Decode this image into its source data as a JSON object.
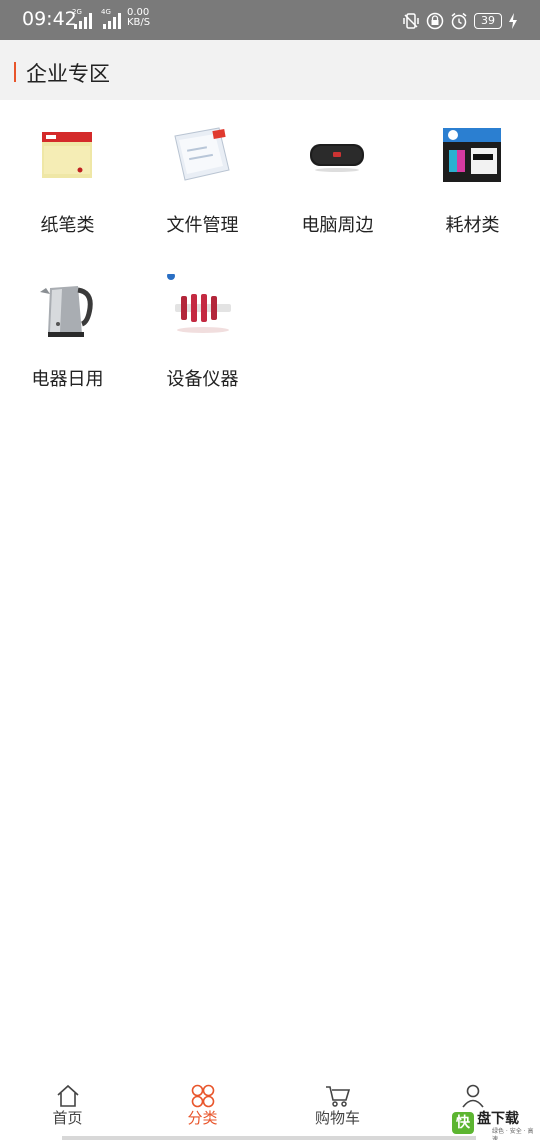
{
  "status_bar": {
    "time": "09:42",
    "sim1_tag": "2G",
    "sim2_tag": "4G",
    "speed_value": "0.00",
    "speed_unit": "KB/S",
    "battery": "39",
    "icons": [
      "vibrate-icon",
      "lock-icon",
      "alarm-icon",
      "battery-icon",
      "charging-icon"
    ]
  },
  "header": {
    "title": "企业专区",
    "accent_color": "#e8552b"
  },
  "categories": [
    {
      "label": "纸笔类",
      "icon": "sticky-notes-image"
    },
    {
      "label": "文件管理",
      "icon": "document-sleeve-image"
    },
    {
      "label": "电脑周边",
      "icon": "speaker-image"
    },
    {
      "label": "耗材类",
      "icon": "ink-cartridge-image"
    },
    {
      "label": "电器日用",
      "icon": "kettle-image"
    },
    {
      "label": "设备仪器",
      "icon": "instrument-image"
    }
  ],
  "bottom_nav": {
    "items": [
      {
        "label": "首页",
        "icon": "home-icon",
        "active": false
      },
      {
        "label": "分类",
        "icon": "category-icon",
        "active": true
      },
      {
        "label": "购物车",
        "icon": "cart-icon",
        "active": false
      },
      {
        "label": "",
        "icon": "user-icon",
        "active": false
      }
    ],
    "active_color": "#e8552b"
  },
  "watermark": {
    "mark": "快",
    "text": "盘下载",
    "sub": "绿色 · 安全 · 高速"
  }
}
